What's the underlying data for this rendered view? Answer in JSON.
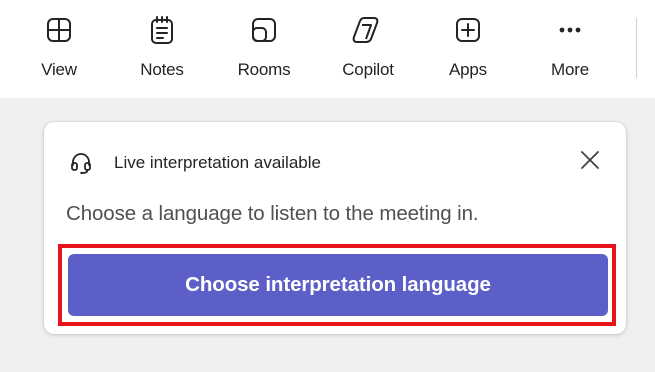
{
  "toolbar": {
    "items": [
      {
        "label": "View",
        "icon": "grid-view-icon"
      },
      {
        "label": "Notes",
        "icon": "notes-icon"
      },
      {
        "label": "Rooms",
        "icon": "rooms-icon"
      },
      {
        "label": "Copilot",
        "icon": "copilot-icon"
      },
      {
        "label": "Apps",
        "icon": "add-apps-icon"
      },
      {
        "label": "More",
        "icon": "more-icon"
      }
    ]
  },
  "notification": {
    "title": "Live interpretation available",
    "description": "Choose a language to listen to the meeting in.",
    "cta_label": "Choose interpretation language",
    "icon": "headset-icon",
    "close_icon": "close-icon"
  },
  "colors": {
    "accent": "#5b5fc7",
    "highlight_outline": "#e8141b",
    "background": "#f0f0f0",
    "card": "#ffffff"
  }
}
